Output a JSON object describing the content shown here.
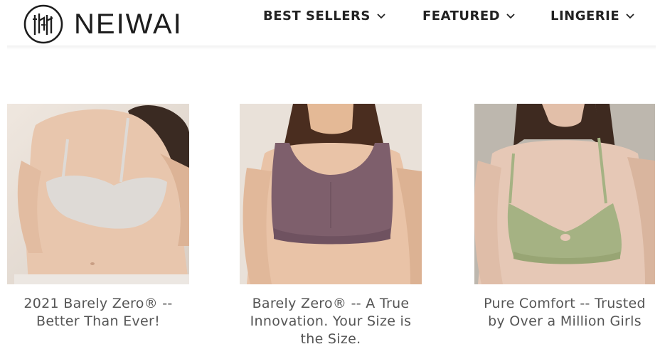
{
  "brand": {
    "name": "NEIWAI",
    "text_color": "#1d1d1d"
  },
  "nav": {
    "items": [
      {
        "label": "BEST SELLERS",
        "icon": "chevron-down-icon"
      },
      {
        "label": "FEATURED",
        "icon": "chevron-down-icon"
      },
      {
        "label": "LINGERIE",
        "icon": "chevron-down-icon"
      }
    ]
  },
  "products": [
    {
      "title": "2021 Barely Zero® -- Better Than Ever!",
      "image": "woman-in-light-grey-wireless-bra",
      "image_colors": {
        "background": "#e7ded6",
        "garment": "#dedad6",
        "skin": "#e8c6ad"
      }
    },
    {
      "title": "Barely Zero® -- A True Innovation. Your Size is the Size.",
      "image": "woman-in-mauve-wireless-bra",
      "image_colors": {
        "background": "#e9e1d9",
        "garment": "#7e5f6c",
        "skin": "#e9c3a7"
      }
    },
    {
      "title": "Pure Comfort -- Trusted by Over a Million Girls",
      "image": "woman-in-sage-green-bralette",
      "image_colors": {
        "background": "#bdb7ae",
        "garment": "#a5b283",
        "skin": "#e6c8b6"
      }
    }
  ],
  "colors": {
    "nav_text": "#222222",
    "title_text": "#555555",
    "page_background": "#ffffff"
  }
}
